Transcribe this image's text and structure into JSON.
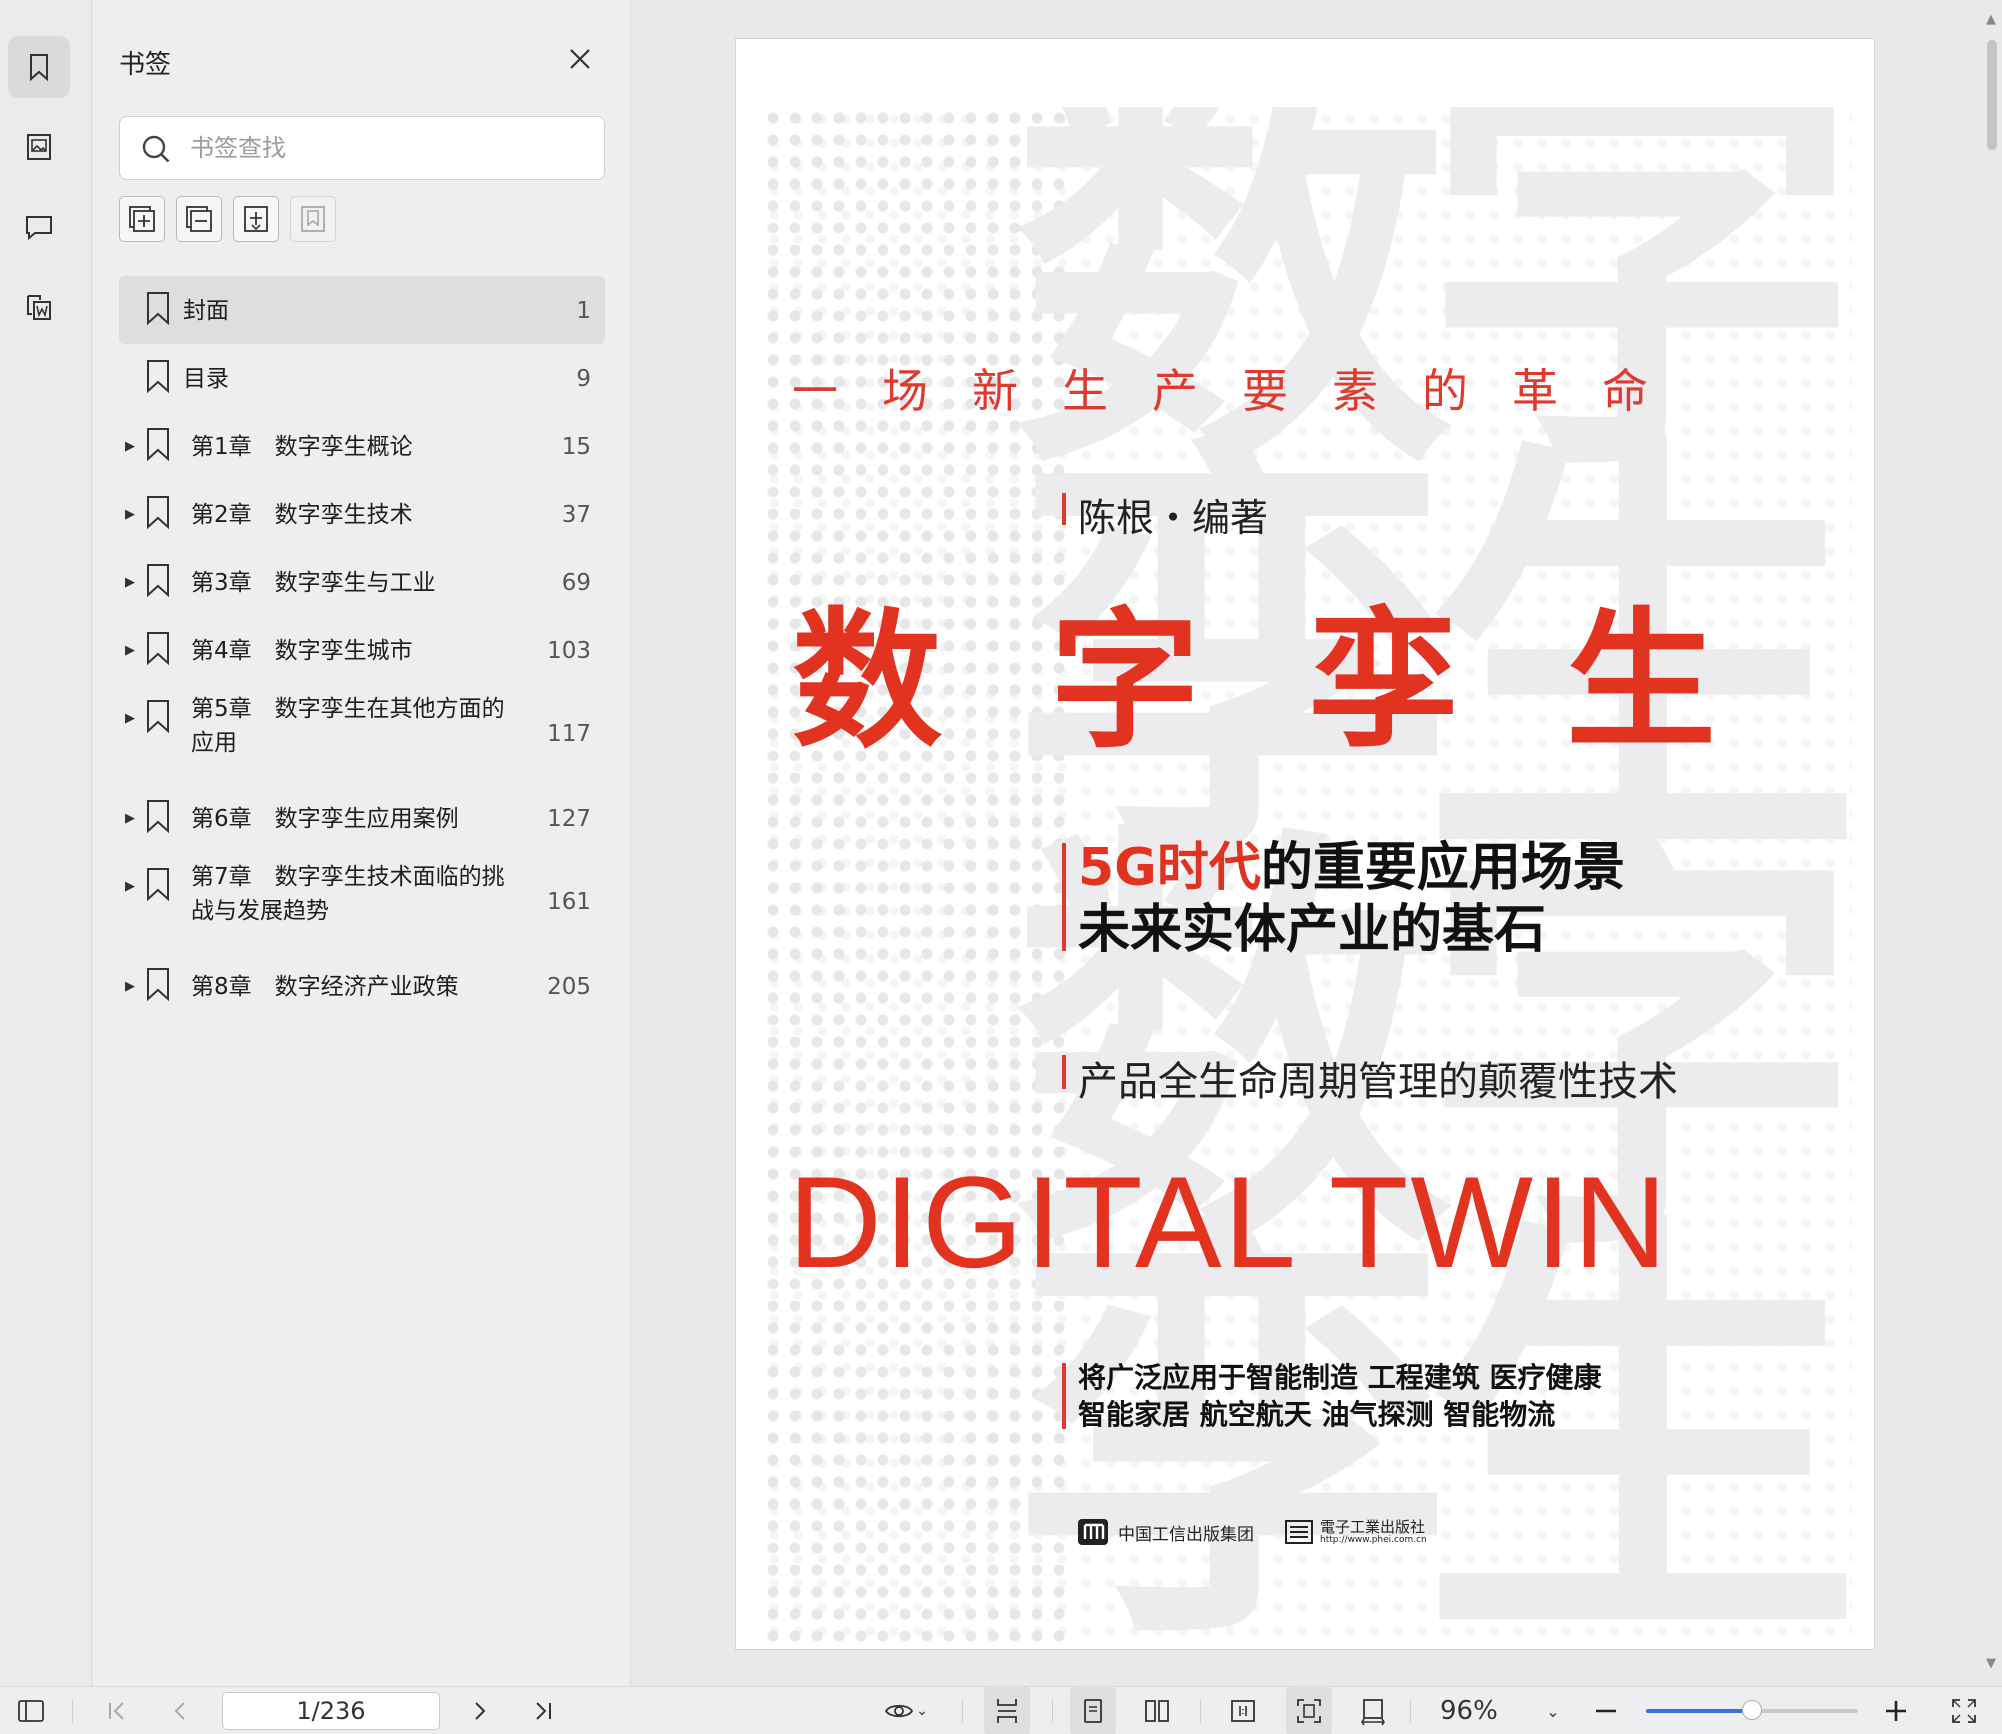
{
  "sidebar": {
    "title": "书签",
    "search_placeholder": "书签查找",
    "bookmarks": [
      {
        "label": "封面",
        "page": "1",
        "expandable": false,
        "selected": true
      },
      {
        "label": "目录",
        "page": "9",
        "expandable": false
      },
      {
        "label": "第1章　数字孪生概论",
        "page": "15",
        "expandable": true
      },
      {
        "label": "第2章　数字孪生技术",
        "page": "37",
        "expandable": true
      },
      {
        "label": "第3章　数字孪生与工业",
        "page": "69",
        "expandable": true
      },
      {
        "label": "第4章　数字孪生城市",
        "page": "103",
        "expandable": true
      },
      {
        "label": "第5章　数字孪生在其他方面的\n应用",
        "page": "117",
        "expandable": true
      },
      {
        "label": "第6章　数字孪生应用案例",
        "page": "127",
        "expandable": true
      },
      {
        "label": "第7章　数字孪生技术面临的挑\n战与发展趋势",
        "page": "161",
        "expandable": true
      },
      {
        "label": "第8章　数字经济产业政策",
        "page": "205",
        "expandable": true
      }
    ]
  },
  "cover": {
    "tagline": "一场新生产要素的革命",
    "author": "陈根・编著",
    "title": "数字孪生",
    "subtitle_red": "5G时代",
    "subtitle_rest": "的重要应用场景",
    "subtitle_line2": "未来实体产业的基石",
    "subtitle2": "产品全生命周期管理的颠覆性技术",
    "english_title": "DIGITAL  TWIN",
    "applications_line1": "将广泛应用于智能制造 工程建筑 医疗健康",
    "applications_line2": "智能家居 航空航天 油气探测 智能物流",
    "publisher1": "中国工信出版集团",
    "publisher2": "電子工業出版社",
    "publisher2_url": "http://www.phei.com.cn"
  },
  "toolbar": {
    "page_indicator": "1/236",
    "zoom": "96%",
    "zoom_fraction": 0.5
  },
  "colors": {
    "accent_red": "#e23320",
    "slider_blue": "#3a6fe3"
  }
}
